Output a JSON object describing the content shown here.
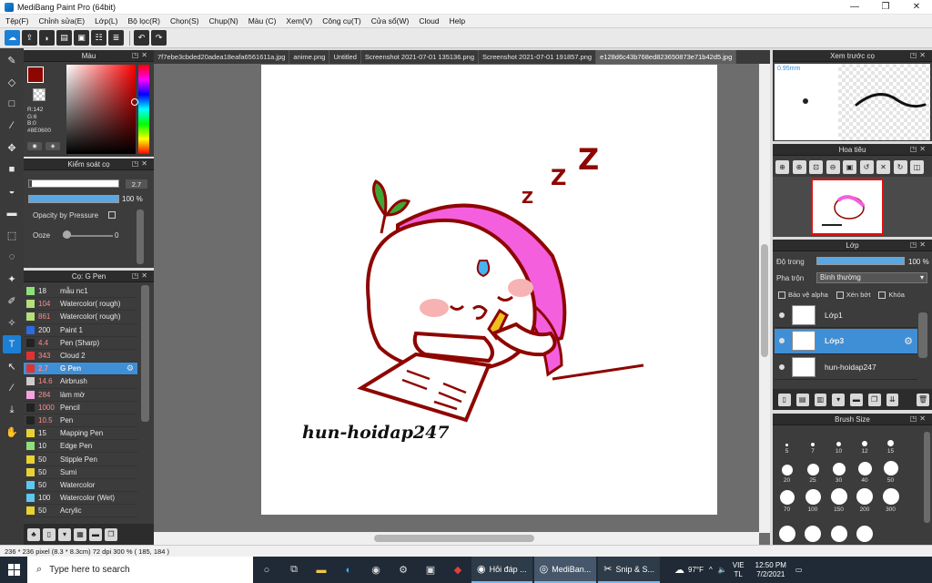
{
  "window": {
    "title": "MediBang Paint Pro (64bit)",
    "minimize": "—",
    "maximize": "❐",
    "close": "✕"
  },
  "menu": [
    "Tệp(F)",
    "Chỉnh sửa(E)",
    "Lớp(L)",
    "Bộ lọc(R)",
    "Chọn(S)",
    "Chụp(N)",
    "Màu (C)",
    "Xem(V)",
    "Công cụ(T)",
    "Cửa sổ(W)",
    "Cloud",
    "Help"
  ],
  "toolbar": {
    "undo": "↶",
    "redo": "↷"
  },
  "color_panel": {
    "title": "Màu",
    "fg_color": "#8E0600",
    "rgb": [
      "R:142",
      "G:6",
      "B:0",
      "#8E0600"
    ]
  },
  "brush_control": {
    "title": "Kiểm soát cọ",
    "size_value": "2.7",
    "opacity_value": "100 %",
    "opacity_fraction": 1.0,
    "pressure_label": "Opacity by Pressure",
    "ooze_label": "Ooze",
    "ooze_value": "0"
  },
  "brush_list": {
    "title": "Cọ: G Pen",
    "items": [
      {
        "size": "18",
        "name": "mẫu nc1",
        "color": "#8ee07a",
        "red": false
      },
      {
        "size": "104",
        "name": "Watercolor( rough)",
        "color": "#b4e07a",
        "red": true
      },
      {
        "size": "861",
        "name": "Watercolor( rough)",
        "color": "#b4e07a",
        "red": true
      },
      {
        "size": "200",
        "name": "Paint 1",
        "color": "#2c6be0",
        "red": false
      },
      {
        "size": "4.4",
        "name": "Pen (Sharp)",
        "color": "#222222",
        "red": true
      },
      {
        "size": "343",
        "name": "Cloud 2",
        "color": "#e03232",
        "red": true
      },
      {
        "size": "2.7",
        "name": "G Pen",
        "color": "#e03232",
        "red": true,
        "selected": true
      },
      {
        "size": "14.6",
        "name": "Airbrush",
        "color": "#cccccc",
        "red": true
      },
      {
        "size": "284",
        "name": "làm mờ",
        "color": "#f5a3e0",
        "red": true
      },
      {
        "size": "1000",
        "name": "Pencil",
        "color": "#222222",
        "red": true
      },
      {
        "size": "10.5",
        "name": "Pen",
        "color": "#222222",
        "red": true
      },
      {
        "size": "15",
        "name": "Mapping Pen",
        "color": "#e8d232",
        "red": false
      },
      {
        "size": "10",
        "name": "Edge Pen",
        "color": "#8ee07a",
        "red": false
      },
      {
        "size": "50",
        "name": "Stipple Pen",
        "color": "#e8d232",
        "red": false
      },
      {
        "size": "50",
        "name": "Sumi",
        "color": "#e8d232",
        "red": false
      },
      {
        "size": "50",
        "name": "Watercolor",
        "color": "#5ec8f0",
        "red": false
      },
      {
        "size": "100",
        "name": "Watercolor (Wet)",
        "color": "#5ec8f0",
        "red": false
      },
      {
        "size": "50",
        "name": "Acrylic",
        "color": "#e8d232",
        "red": false
      }
    ]
  },
  "tabs": [
    "7f7ebe3cbded20adea18eafa6561611a.jpg",
    "anime.png",
    "Untitled",
    "Screenshot 2021-07-01 135136.png",
    "Screenshot 2021-07-01 191857.png",
    "e128d6c43b768ed823650873e71b42d5.jpg"
  ],
  "canvas": {
    "watermark": "hun-hoidap247",
    "zzz": "Z"
  },
  "preview_panel": {
    "title": "Xem trước cọ",
    "size": "0.95mm"
  },
  "navigator": {
    "title": "Hoa tiêu"
  },
  "layer_panel": {
    "title": "Lớp",
    "opacity_label": "Độ trong",
    "opacity_value": "100 %",
    "blend_label": "Pha trộn",
    "blend_value": "Bình thường",
    "checks": [
      "Bảo vệ alpha",
      "Xén bớt",
      "Khóa"
    ],
    "layers": [
      {
        "name": "Lớp1",
        "selected": false
      },
      {
        "name": "Lớp3",
        "selected": true
      },
      {
        "name": "hun-hoidap247",
        "selected": false
      }
    ]
  },
  "brush_size": {
    "title": "Brush Size",
    "sizes": [
      "5",
      "7",
      "10",
      "12",
      "15",
      "20",
      "25",
      "30",
      "40",
      "50",
      "70",
      "100",
      "150",
      "200",
      "300"
    ]
  },
  "status": {
    "text": "236 * 236 pixel  (8.3 * 8.3cm)  72 dpi  300 %  ( 185, 184 )"
  },
  "taskbar": {
    "search_placeholder": "Type here to search",
    "apps": [
      {
        "label": "Hỏi đáp ...",
        "active": false
      },
      {
        "label": "MediBan...",
        "active": true
      },
      {
        "label": "Snip & S...",
        "active": false
      }
    ],
    "weather": "97°F",
    "lang": [
      "VIE",
      "TL"
    ],
    "time": "12:50 PM",
    "date": "7/2/2021"
  }
}
